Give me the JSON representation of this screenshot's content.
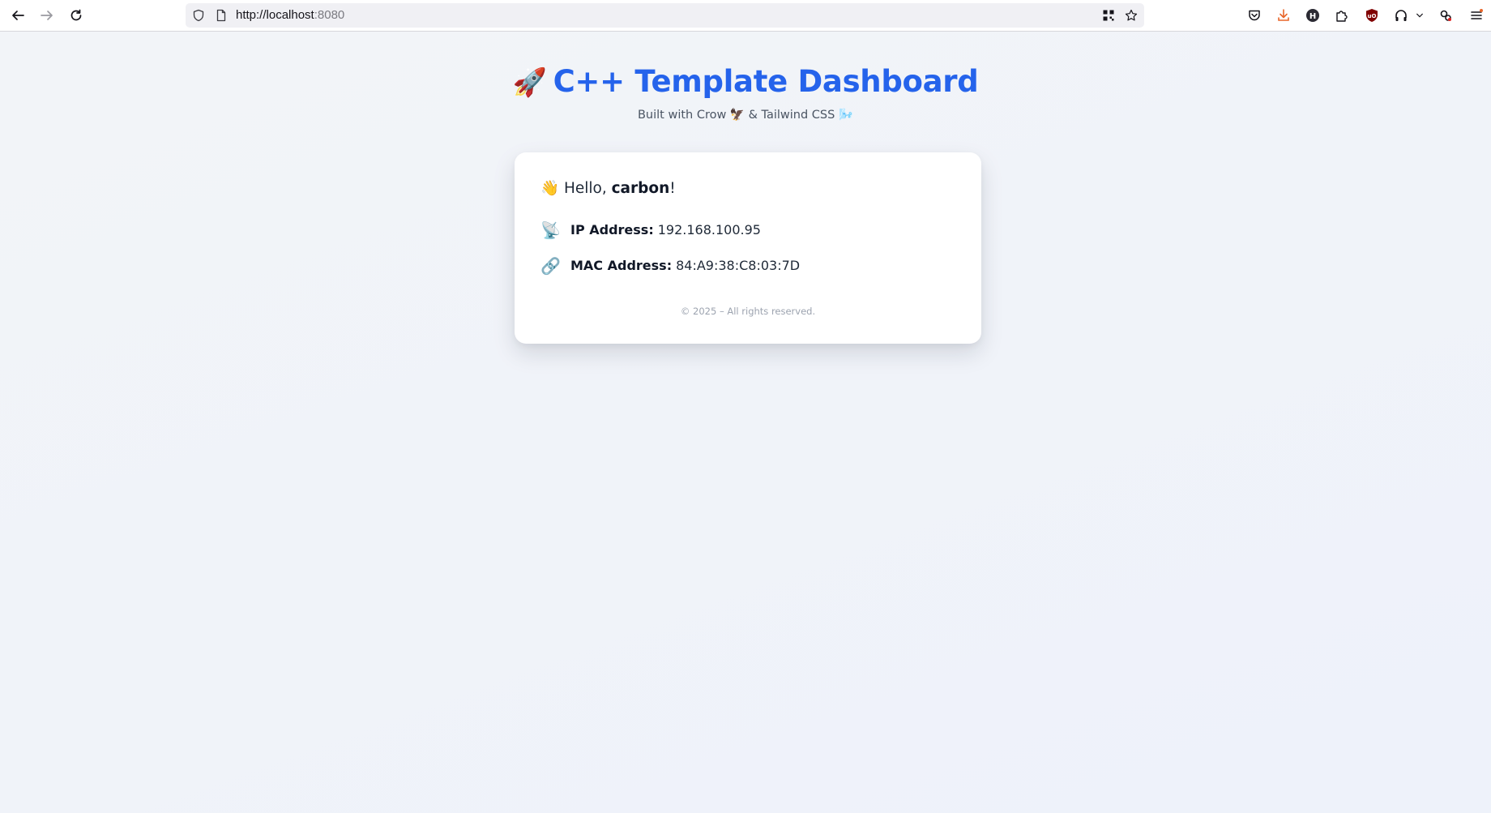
{
  "browser": {
    "url_host": "http://localhost",
    "url_port": ":8080",
    "icons": {
      "back": "back-arrow-icon",
      "forward": "forward-arrow-icon",
      "reload": "reload-icon",
      "shield": "shield-icon",
      "page": "page-icon",
      "qr": "qr-code-icon",
      "bookmark": "star-icon",
      "pocket": "pocket-icon",
      "downloads": "download-icon",
      "extensions": [
        "h-extension-icon",
        "puzzle-icon",
        "ublock-icon",
        "headphones-icon",
        "gear-extension-icon"
      ],
      "menu": "hamburger-menu-icon"
    }
  },
  "header": {
    "emoji": "🚀",
    "title": "C++ Template Dashboard",
    "subtitle": "Built with Crow 🦅 & Tailwind CSS 🌬️"
  },
  "card": {
    "greeting_emoji": "👋",
    "greeting_prefix": "Hello, ",
    "username": "carbon",
    "greeting_suffix": "!",
    "ip": {
      "emoji": "📡",
      "label": "IP Address:",
      "value": "192.168.100.95"
    },
    "mac": {
      "emoji": "🔗",
      "label": "MAC Address:",
      "value": "84:A9:38:C8:03:7D"
    },
    "footer": "© 2025 – All rights reserved."
  },
  "colors": {
    "accent": "#2563eb",
    "background": "#f1f4f9",
    "card": "#ffffff",
    "download_accent": "#e8662a",
    "ublock_red": "#800000"
  }
}
